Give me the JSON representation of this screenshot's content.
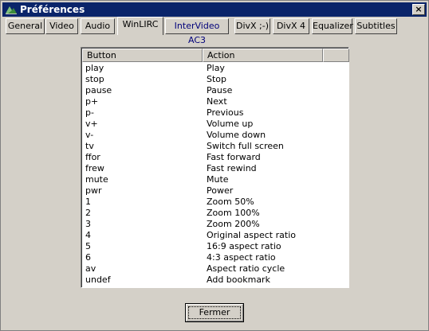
{
  "window": {
    "title": "Préférences",
    "close_label": "×"
  },
  "tabs": [
    {
      "label": "General"
    },
    {
      "label": "Video"
    },
    {
      "label": "Audio"
    },
    {
      "label": "WinLIRC"
    },
    {
      "label": "InterVideo AC3"
    },
    {
      "label": "DivX ;-)"
    },
    {
      "label": "DivX 4"
    },
    {
      "label": "Equalizer"
    },
    {
      "label": "Subtitles"
    }
  ],
  "active_tab": "WinLIRC",
  "table": {
    "headers": [
      "Button",
      "Action"
    ],
    "rows": [
      [
        "play",
        "Play"
      ],
      [
        "stop",
        "Stop"
      ],
      [
        "pause",
        "Pause"
      ],
      [
        "p+",
        "Next"
      ],
      [
        "p-",
        "Previous"
      ],
      [
        "v+",
        "Volume up"
      ],
      [
        "v-",
        "Volume down"
      ],
      [
        "tv",
        "Switch full screen"
      ],
      [
        "ffor",
        "Fast forward"
      ],
      [
        "frew",
        "Fast rewind"
      ],
      [
        "mute",
        "Mute"
      ],
      [
        "pwr",
        "Power"
      ],
      [
        "1",
        "Zoom 50%"
      ],
      [
        "2",
        "Zoom 100%"
      ],
      [
        "3",
        "Zoom 200%"
      ],
      [
        "4",
        "Original aspect ratio"
      ],
      [
        "5",
        "16:9 aspect ratio"
      ],
      [
        "6",
        "4:3 aspect ratio"
      ],
      [
        "av",
        "Aspect ratio cycle"
      ],
      [
        "undef",
        "Add bookmark"
      ]
    ]
  },
  "buttons": {
    "close_label": "Fermer"
  }
}
